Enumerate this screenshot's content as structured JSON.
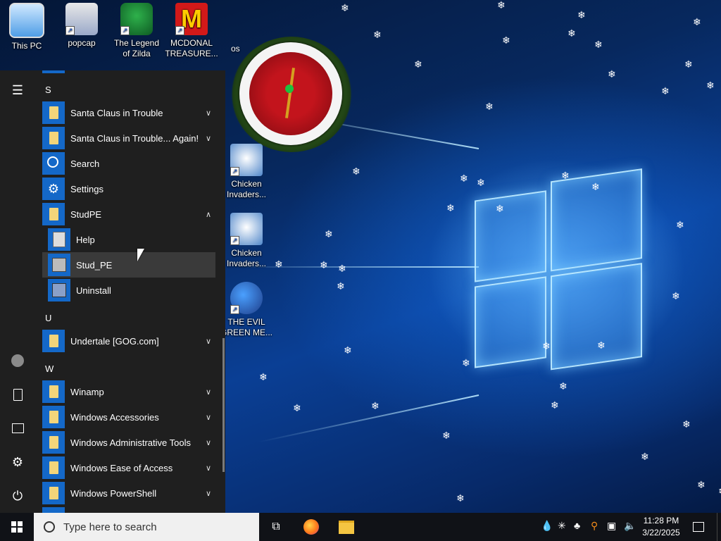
{
  "desktop": {
    "icons": [
      {
        "label": "This PC",
        "icon": "computer-icon"
      },
      {
        "label": "popcap",
        "icon": "folder-icon"
      },
      {
        "label": "The Legend of Zilda",
        "icon": "game-icon"
      },
      {
        "label": "MCDONAL TREASURE...",
        "icon": "mcdonalds-icon"
      },
      {
        "label": "Chicken Invaders...",
        "icon": "chicken-icon"
      },
      {
        "label": "Chicken Invaders...",
        "icon": "chicken-icon"
      },
      {
        "label": "THE EVIL GREEN ME...",
        "icon": "people-icon"
      }
    ],
    "partial_label": "os",
    "colors": {
      "wallpaper": "#0a3f95",
      "glow": "#8fd2ff"
    }
  },
  "start_menu": {
    "rail": {
      "menu": "hamburger-icon",
      "account": "account-icon",
      "documents": "document-icon",
      "pictures": "pictures-icon",
      "settings": "gear-icon",
      "power": "power-icon"
    },
    "groups": [
      {
        "letter": "S"
      },
      {
        "letter": "U"
      },
      {
        "letter": "W"
      }
    ],
    "apps": {
      "santa1": "Santa Claus in Trouble",
      "santa2": "Santa Claus in Trouble... Again!",
      "search": "Search",
      "settings": "Settings",
      "studpe": "StudPE",
      "help": "Help",
      "stud_pe": "Stud_PE",
      "uninstall": "Uninstall",
      "undertale": "Undertale [GOG.com]",
      "winamp": "Winamp",
      "accessories": "Windows Accessories",
      "admin": "Windows Administrative Tools",
      "ease": "Windows Ease of Access",
      "powershell": "Windows PowerShell"
    }
  },
  "taskbar": {
    "search_placeholder": "Type here to search",
    "time": "11:28 PM",
    "date": "3/22/2025",
    "pinned": [
      "task-view-icon",
      "firefox-icon",
      "file-explorer-icon"
    ],
    "tray": [
      "water-drop-icon",
      "snowflake-icon",
      "network-people-icon",
      "search-tool-icon",
      "network-icon",
      "volume-icon",
      "notification-icon"
    ]
  }
}
